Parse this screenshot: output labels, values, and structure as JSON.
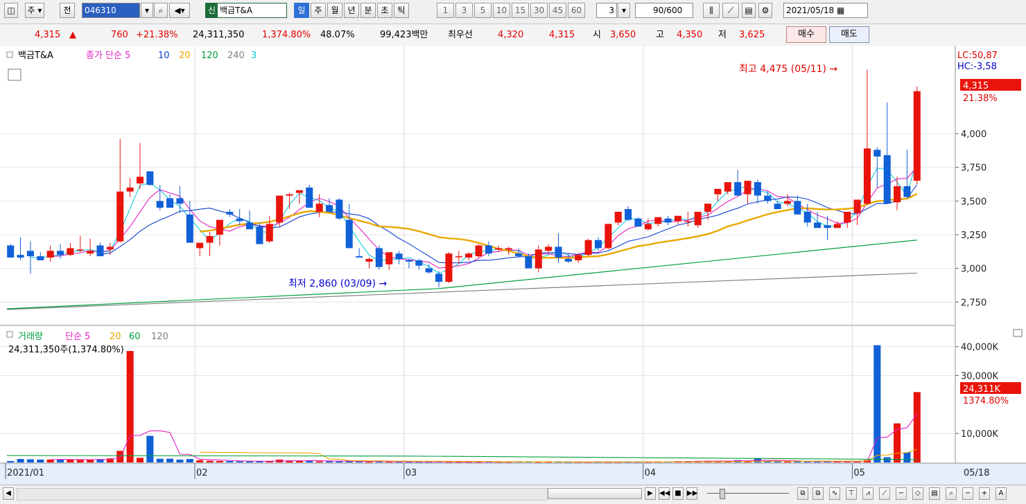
{
  "toolbar": {
    "market_label": "주",
    "prev_label": "전",
    "stock_code": "046310",
    "stock_tag": "신",
    "stock_name": "백금T&A",
    "periods": [
      "일",
      "주",
      "월",
      "년",
      "분",
      "초",
      "틱"
    ],
    "active_period": "일",
    "intervals": [
      "1",
      "3",
      "5",
      "10",
      "15",
      "30",
      "45",
      "60"
    ],
    "interval_value": "3",
    "count_value": "90",
    "count_max": "/600",
    "date": "2021/05/18"
  },
  "quote": {
    "price": "4,315",
    "direction": "▲",
    "change": "760",
    "change_pct": "+21.38%",
    "volume": "24,311,350",
    "volume_pct": "1,374.80%",
    "turnover_pct": "48.07%",
    "amount": "99,423백만",
    "best_bid_label": "최우선",
    "best_ask": "4,320",
    "best_bid": "4,315",
    "open_label": "시",
    "open": "3,650",
    "high_label": "고",
    "high": "4,350",
    "low_label": "저",
    "low": "3,625",
    "buy_label": "매수",
    "sell_label": "매도"
  },
  "price_panel": {
    "stock_name": "백금T&A",
    "ma_title": "종가 단순",
    "ma_periods": [
      "5",
      "10",
      "20",
      "120",
      "240",
      "3"
    ],
    "ma_colors": [
      "#e020c0",
      "#1040d0",
      "#e8a800",
      "#00a040",
      "#808080",
      "#00c8d8"
    ],
    "lc": "LC:50,87",
    "hc": "HC:-3,58",
    "last_price_tag": "4,315",
    "last_pct": "21.38%",
    "high_note": "최고 4,475 (05/11)",
    "low_note": "최저 2,860 (03/09)",
    "y_ticks": [
      "4,000",
      "3,750",
      "3,500",
      "3,250",
      "3,000",
      "2,750"
    ]
  },
  "volume_panel": {
    "title": "거래량",
    "ma_title": "단순",
    "ma_periods": [
      "5",
      "20",
      "60",
      "120"
    ],
    "current": "24,311,350주(1,374.80%)",
    "last_tag": "24,311K",
    "last_pct": "1374.80%",
    "y_ticks": [
      "40,000K",
      "30,000K",
      "10,000K"
    ]
  },
  "x_axis": {
    "labels": [
      "2021/01",
      "02",
      "03",
      "04",
      "05"
    ],
    "end_label": "05/18"
  },
  "colors": {
    "up": "#e8140c",
    "down": "#1060d8",
    "accent": "#2f6fd6"
  },
  "chart_data": {
    "type": "candlestick",
    "dates_start": "2021/01",
    "dates_end": "05/18",
    "ohlc": [
      [
        3170,
        3180,
        3080,
        3080
      ],
      [
        3100,
        3230,
        3060,
        3080
      ],
      [
        3130,
        3200,
        2960,
        3090
      ],
      [
        3090,
        3120,
        3060,
        3060
      ],
      [
        3080,
        3170,
        3050,
        3130
      ],
      [
        3130,
        3180,
        3070,
        3100
      ],
      [
        3100,
        3190,
        3090,
        3150
      ],
      [
        3140,
        3240,
        3120,
        3140
      ],
      [
        3110,
        3220,
        3090,
        3130
      ],
      [
        3170,
        3190,
        3100,
        3090
      ],
      [
        3140,
        3190,
        3100,
        3160
      ],
      [
        3200,
        3960,
        3190,
        3570
      ],
      [
        3570,
        3670,
        3530,
        3600
      ],
      [
        3630,
        3930,
        3590,
        3680
      ],
      [
        3720,
        3720,
        3610,
        3620
      ],
      [
        3500,
        3620,
        3430,
        3450
      ],
      [
        3520,
        3550,
        3500,
        3450
      ],
      [
        3520,
        3610,
        3410,
        3480
      ],
      [
        3400,
        3500,
        3370,
        3190
      ],
      [
        3150,
        3190,
        3090,
        3190
      ],
      [
        3190,
        3270,
        3090,
        3240
      ],
      [
        3250,
        3340,
        3170,
        3360
      ],
      [
        3420,
        3440,
        3380,
        3400
      ],
      [
        3370,
        3440,
        3320,
        3350
      ],
      [
        3340,
        3430,
        3320,
        3290
      ],
      [
        3310,
        3340,
        3210,
        3180
      ],
      [
        3200,
        3390,
        3190,
        3330
      ],
      [
        3340,
        3400,
        3310,
        3540
      ],
      [
        3540,
        3560,
        3440,
        3550
      ],
      [
        3560,
        3570,
        3480,
        3580
      ],
      [
        3600,
        3620,
        3450,
        3450
      ],
      [
        3420,
        3550,
        3380,
        3480
      ],
      [
        3470,
        3520,
        3420,
        3420
      ],
      [
        3510,
        3520,
        3360,
        3370
      ],
      [
        3360,
        3480,
        3360,
        3150
      ],
      [
        3090,
        3150,
        3080,
        3080
      ],
      [
        3050,
        3080,
        3000,
        3070
      ],
      [
        3150,
        3170,
        2990,
        3010
      ],
      [
        3030,
        3090,
        2990,
        3120
      ],
      [
        3110,
        3130,
        3030,
        3070
      ],
      [
        3060,
        3070,
        3000,
        3050
      ],
      [
        3060,
        3070,
        2990,
        3020
      ],
      [
        3000,
        3030,
        2960,
        2970
      ],
      [
        2960,
        2980,
        2860,
        2900
      ],
      [
        2900,
        3120,
        2890,
        3110
      ],
      [
        3090,
        3130,
        3030,
        3090
      ],
      [
        3080,
        3120,
        3060,
        3110
      ],
      [
        3090,
        3180,
        3080,
        3170
      ],
      [
        3170,
        3200,
        3090,
        3110
      ],
      [
        3140,
        3170,
        3120,
        3150
      ],
      [
        3140,
        3160,
        3100,
        3150
      ],
      [
        3110,
        3150,
        3080,
        3090
      ],
      [
        3090,
        3110,
        3020,
        3000
      ],
      [
        3000,
        3170,
        2970,
        3140
      ],
      [
        3130,
        3180,
        3110,
        3160
      ],
      [
        3160,
        3260,
        3040,
        3080
      ],
      [
        3070,
        3110,
        3040,
        3050
      ],
      [
        3060,
        3110,
        3040,
        3100
      ],
      [
        3100,
        3220,
        3090,
        3210
      ],
      [
        3210,
        3230,
        3130,
        3150
      ],
      [
        3150,
        3330,
        3140,
        3330
      ],
      [
        3340,
        3420,
        3320,
        3420
      ],
      [
        3440,
        3460,
        3350,
        3360
      ],
      [
        3370,
        3380,
        3310,
        3310
      ],
      [
        3290,
        3370,
        3280,
        3330
      ],
      [
        3330,
        3370,
        3310,
        3380
      ],
      [
        3370,
        3390,
        3320,
        3340
      ],
      [
        3350,
        3390,
        3330,
        3390
      ],
      [
        3350,
        3420,
        3310,
        3350
      ],
      [
        3320,
        3390,
        3300,
        3420
      ],
      [
        3420,
        3440,
        3360,
        3480
      ],
      [
        3550,
        3590,
        3500,
        3590
      ],
      [
        3570,
        3620,
        3550,
        3640
      ],
      [
        3640,
        3730,
        3540,
        3540
      ],
      [
        3550,
        3640,
        3480,
        3650
      ],
      [
        3640,
        3660,
        3480,
        3540
      ],
      [
        3540,
        3570,
        3480,
        3500
      ],
      [
        3480,
        3500,
        3440,
        3440
      ],
      [
        3480,
        3550,
        3460,
        3500
      ],
      [
        3500,
        3540,
        3420,
        3400
      ],
      [
        3420,
        3480,
        3310,
        3340
      ],
      [
        3340,
        3420,
        3300,
        3300
      ],
      [
        3320,
        3390,
        3210,
        3300
      ],
      [
        3300,
        3350,
        3300,
        3330
      ],
      [
        3340,
        3390,
        3300,
        3420
      ],
      [
        3410,
        3440,
        3320,
        3510
      ],
      [
        3480,
        4475,
        3470,
        3890
      ],
      [
        3880,
        3900,
        3600,
        3830
      ],
      [
        3840,
        4230,
        3480,
        3480
      ],
      [
        3490,
        3680,
        3430,
        3610
      ],
      [
        3610,
        3880,
        3520,
        3530
      ],
      [
        3650,
        4350,
        3625,
        4315
      ]
    ],
    "volume_k": [
      500,
      1200,
      1100,
      1000,
      1000,
      1000,
      1000,
      900,
      900,
      1200,
      1400,
      4000,
      38500,
      1600,
      9200,
      1300,
      1300,
      1000,
      1200,
      800,
      600,
      500,
      500,
      400,
      400,
      400,
      400,
      1000,
      700,
      500,
      600,
      400,
      400,
      500,
      400,
      300,
      200,
      300,
      300,
      200,
      200,
      200,
      200,
      300,
      200,
      200,
      200,
      200,
      200,
      200,
      200,
      300,
      300,
      200,
      200,
      200,
      200,
      200,
      200,
      200,
      200,
      200,
      200,
      200,
      200,
      300,
      300,
      400,
      400,
      500,
      600,
      400,
      400,
      800,
      600,
      1500,
      400,
      400,
      300,
      300,
      300,
      400,
      300,
      300,
      300,
      400,
      800,
      40500,
      1800,
      13500,
      3500,
      24311
    ],
    "y_range": [
      2700,
      4550
    ],
    "volume_range_k": [
      0,
      44000
    ]
  }
}
